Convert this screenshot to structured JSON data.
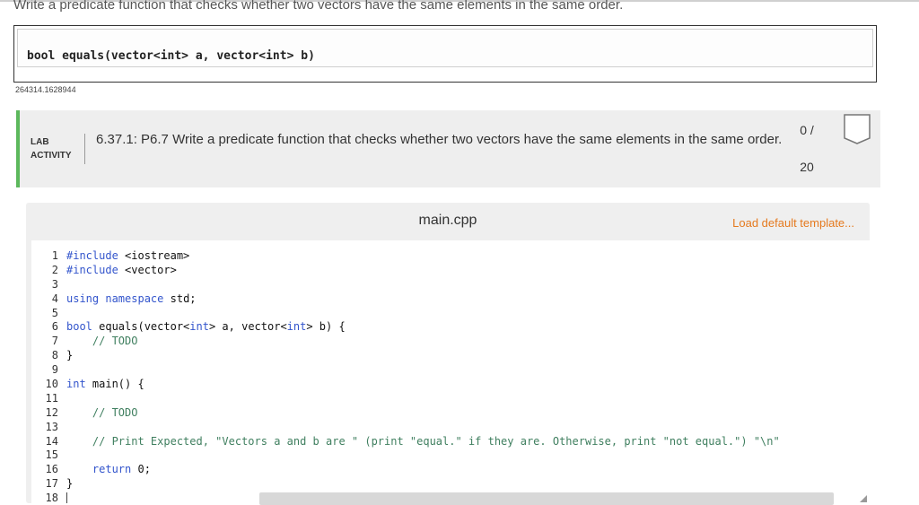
{
  "prompt": "Write a predicate function that checks whether two vectors have the same elements in the same order.",
  "signature": "bool equals(vector<int> a, vector<int> b)",
  "reference_id": "264314.1628944",
  "lab": {
    "label_line1": "LAB",
    "label_line2": "ACTIVITY",
    "title": "6.37.1: P6.7 Write a predicate function that checks whether two vectors have the same elements in the same order.",
    "score_earned": "0 /",
    "score_total": "20",
    "status_icon": "incomplete-badge-icon",
    "accent_color": "#5cb85c"
  },
  "editor": {
    "filename": "main.cpp",
    "load_template_label": "Load default template...",
    "link_color": "#e57a1f",
    "line_numbers": [
      "1",
      "2",
      "3",
      "4",
      "5",
      "6",
      "7",
      "8",
      "9",
      "10",
      "11",
      "12",
      "13",
      "14",
      "15",
      "16",
      "17",
      "18"
    ],
    "lines": [
      "#include <iostream>",
      "#include <vector>",
      "",
      "using namespace std;",
      "",
      "bool equals(vector<int> a, vector<int> b) {",
      "    // TODO",
      "}",
      "",
      "int main() {",
      "",
      "    // TODO",
      "",
      "    // Print Expected, \"Vectors a and b are \" (print \"equal.\" if they are. Otherwise, print \"not equal.\") \"\\n\"",
      "",
      "    return 0;",
      "}",
      ""
    ]
  }
}
